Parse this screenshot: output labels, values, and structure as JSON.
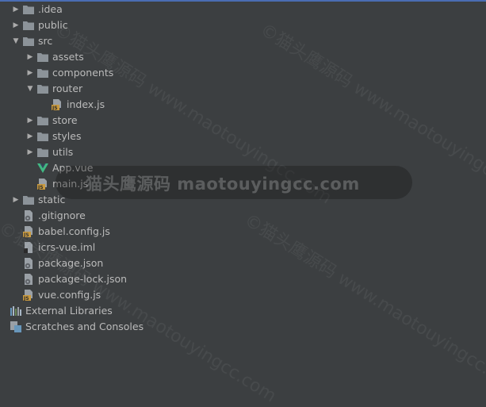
{
  "tree": {
    "items": [
      {
        "label": ".idea",
        "type": "folder",
        "arrow": "collapsed",
        "depth": 0
      },
      {
        "label": "public",
        "type": "folder",
        "arrow": "collapsed",
        "depth": 0
      },
      {
        "label": "src",
        "type": "folder",
        "arrow": "expanded",
        "depth": 0
      },
      {
        "label": "assets",
        "type": "folder",
        "arrow": "collapsed",
        "depth": 1
      },
      {
        "label": "components",
        "type": "folder",
        "arrow": "collapsed",
        "depth": 1
      },
      {
        "label": "router",
        "type": "folder",
        "arrow": "expanded",
        "depth": 1
      },
      {
        "label": "index.js",
        "type": "js",
        "arrow": "none",
        "depth": 2
      },
      {
        "label": "store",
        "type": "folder",
        "arrow": "collapsed",
        "depth": 1
      },
      {
        "label": "styles",
        "type": "folder",
        "arrow": "collapsed",
        "depth": 1
      },
      {
        "label": "utils",
        "type": "folder",
        "arrow": "collapsed",
        "depth": 1
      },
      {
        "label": "App.vue",
        "type": "vue",
        "arrow": "none",
        "depth": 1
      },
      {
        "label": "main.js",
        "type": "js",
        "arrow": "none",
        "depth": 1
      },
      {
        "label": "static",
        "type": "folder",
        "arrow": "collapsed",
        "depth": 0
      },
      {
        "label": ".gitignore",
        "type": "config",
        "arrow": "none",
        "depth": 0
      },
      {
        "label": "babel.config.js",
        "type": "js",
        "arrow": "none",
        "depth": 0
      },
      {
        "label": "icrs-vue.iml",
        "type": "iml",
        "arrow": "none",
        "depth": 0
      },
      {
        "label": "package.json",
        "type": "config",
        "arrow": "none",
        "depth": 0
      },
      {
        "label": "package-lock.json",
        "type": "config",
        "arrow": "none",
        "depth": 0
      },
      {
        "label": "vue.config.js",
        "type": "js",
        "arrow": "none",
        "depth": 0
      },
      {
        "label": "External Libraries",
        "type": "libraries",
        "arrow": "none",
        "depth": -1
      },
      {
        "label": "Scratches and Consoles",
        "type": "scratches",
        "arrow": "none",
        "depth": -1
      }
    ]
  },
  "watermark": {
    "text": "猫头鹰源码 maotouyingcc.com",
    "diagonal": "©猫头鹰源码 www.maotouyingcc.com"
  },
  "colors": {
    "background": "#3c3f41",
    "text": "#bbbbbb",
    "folder": "#8c9399",
    "js_badge": "#c99a3f",
    "vue_green": "#41b883",
    "accent_bar": "#4a6db3"
  }
}
